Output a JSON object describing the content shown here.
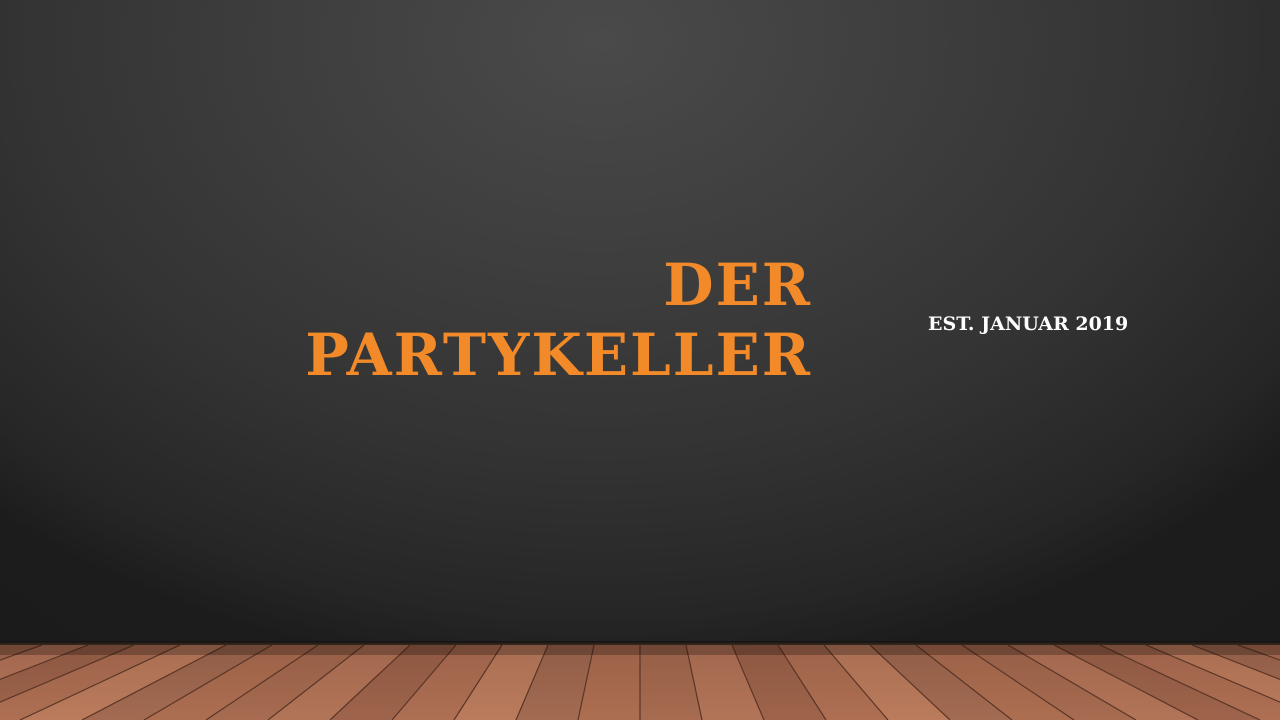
{
  "slide": {
    "title_line1": "DER",
    "title_line2": "PARTYKELLER",
    "subtitle": "EST. JANUAR 2019"
  },
  "colors": {
    "title": "#f28a2a",
    "subtitle": "#ffffff",
    "wall": "#3a3a3a",
    "floor": "#a86a4e"
  }
}
